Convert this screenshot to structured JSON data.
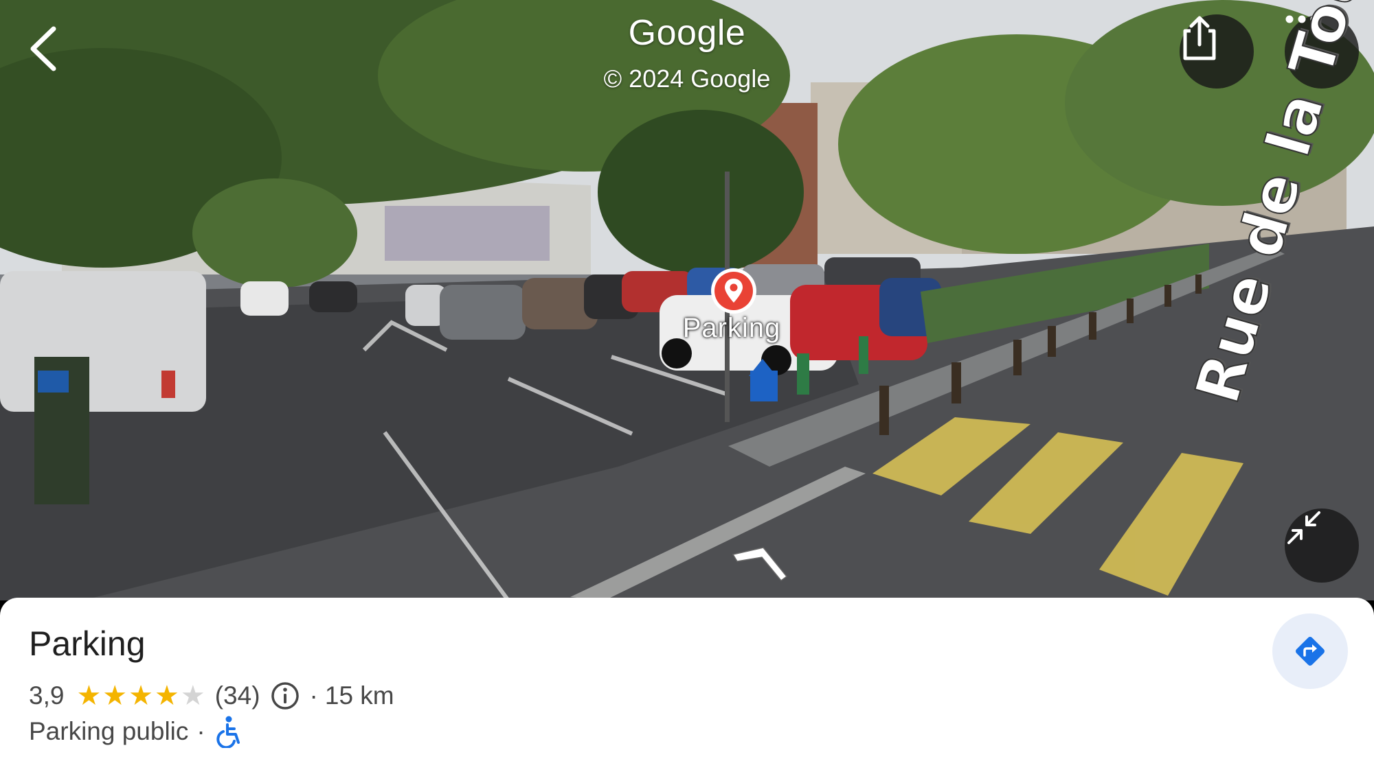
{
  "header": {
    "brand": "Google",
    "copyright": "© 2024 Google",
    "back_icon": "chevron-left-icon",
    "share_icon": "share-icon",
    "more_icon": "more-horizontal-icon"
  },
  "street_view": {
    "pin_label": "Parking",
    "street_name": "Rue de la Tour Neuve",
    "collapse_icon": "collapse-icon",
    "nav_arrow_icon": "navigation-arrow-icon"
  },
  "place_card": {
    "title": "Parking",
    "rating": "3,9",
    "stars": [
      1,
      1,
      1,
      1,
      0
    ],
    "reviews": "(34)",
    "distance": "15 km",
    "separator": "·",
    "category": "Parking public",
    "directions_icon": "directions-icon",
    "accessibility_icon": "wheelchair-icon"
  },
  "colors": {
    "pin": "#e94235",
    "star": "#f4b400",
    "accent": "#1a73e8",
    "crosswalk": "#d6bf55"
  }
}
